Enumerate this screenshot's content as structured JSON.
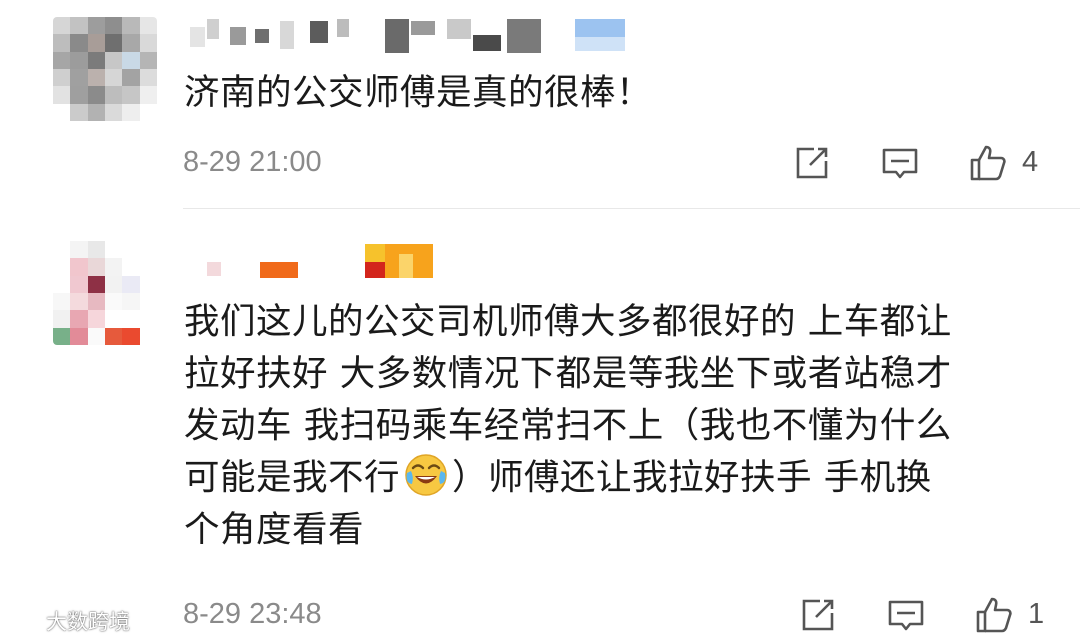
{
  "comments": [
    {
      "text": "济南的公交师傅是真的很棒！",
      "time": "8-29 21:00",
      "likes": "4"
    },
    {
      "text": "我们这儿的公交司机师傅大多都很好的 上车都让\n拉好扶好 大多数情况下都是等我坐下或者站稳才\n发动车 我扫码乘车经常扫不上（我也不懂为什么\n可能是我不行",
      "text_after_emoji": "）师傅还让我拉好扶手 手机换\n个角度看看",
      "emoji": "laugh-cry-emoji",
      "time": "8-29 23:48",
      "likes": "1"
    }
  ],
  "icons": {
    "forward": "share-edit-icon",
    "reply": "comment-icon",
    "like": "thumbs-up-icon"
  },
  "watermark": {
    "text": "大数跨境"
  },
  "colors": {
    "text": "#1a1a1a",
    "meta": "#8a8a8a",
    "icon": "#555555",
    "divider": "#e8e8e8"
  }
}
